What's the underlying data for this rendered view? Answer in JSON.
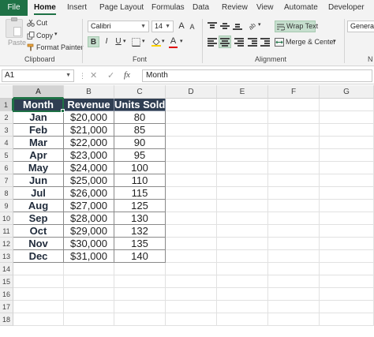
{
  "tabs": [
    "File",
    "Home",
    "Insert",
    "Page Layout",
    "Formulas",
    "Data",
    "Review",
    "View",
    "Automate",
    "Developer"
  ],
  "ribbon": {
    "clipboard": {
      "paste_label": "Paste",
      "cut_label": "Cut",
      "copy_label": "Copy",
      "format_painter_label": "Format Painter",
      "group_label": "Clipboard"
    },
    "font": {
      "font_name": "Calibri",
      "font_size": "14",
      "bold": "B",
      "italic": "I",
      "underline": "U",
      "grow_font": "A",
      "shrink_font": "A",
      "font_color": "A",
      "group_label": "Font"
    },
    "alignment": {
      "wrap_text_label": "Wrap Text",
      "merge_center_label": "Merge & Center",
      "group_label": "Alignment"
    },
    "number": {
      "format_value": "General",
      "group_label_partial": "N"
    }
  },
  "formula_bar": {
    "name_box": "A1",
    "cancel_glyph": "✕",
    "enter_glyph": "✓",
    "fx_label": "fx",
    "content": "Month"
  },
  "grid": {
    "columns": [
      "A",
      "B",
      "C",
      "D",
      "E",
      "F",
      "G"
    ],
    "rows": [
      "1",
      "2",
      "3",
      "4",
      "5",
      "6",
      "7",
      "8",
      "9",
      "10",
      "11",
      "12",
      "13",
      "14",
      "15",
      "16",
      "17",
      "18"
    ],
    "header_cells": [
      "Month",
      "Revenue",
      "Units Sold"
    ],
    "data_rows": [
      [
        "Jan",
        "$20,000",
        "80"
      ],
      [
        "Feb",
        "$21,000",
        "85"
      ],
      [
        "Mar",
        "$22,000",
        "90"
      ],
      [
        "Apr",
        "$23,000",
        "95"
      ],
      [
        "May",
        "$24,000",
        "100"
      ],
      [
        "Jun",
        "$25,000",
        "110"
      ],
      [
        "Jul",
        "$26,000",
        "115"
      ],
      [
        "Aug",
        "$27,000",
        "125"
      ],
      [
        "Sep",
        "$28,000",
        "130"
      ],
      [
        "Oct",
        "$29,000",
        "132"
      ],
      [
        "Nov",
        "$30,000",
        "135"
      ],
      [
        "Dec",
        "$31,000",
        "140"
      ]
    ],
    "selected_cell": "A1"
  },
  "colors": {
    "accent": "#1e7145",
    "table_header_fill": "#2f3e52",
    "ribbon_selected": "#c6dfce"
  }
}
